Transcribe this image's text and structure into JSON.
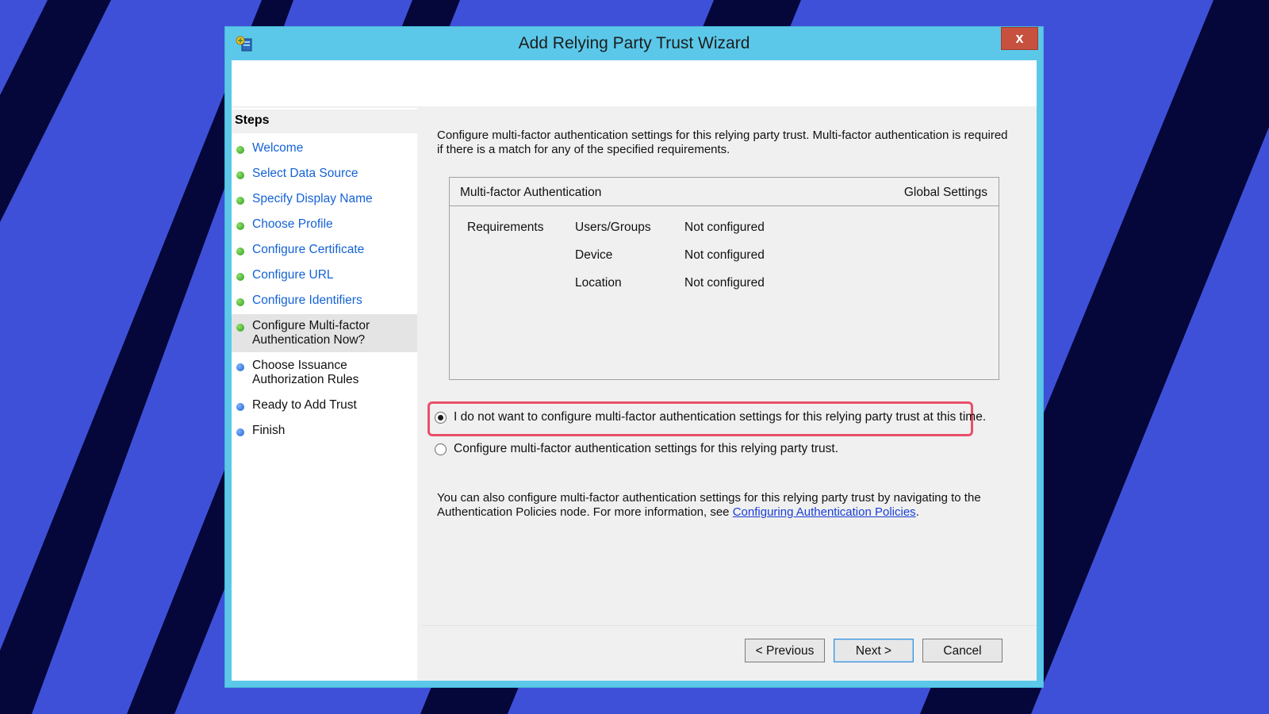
{
  "window": {
    "title": "Add Relying Party Trust Wizard",
    "close_label": "x"
  },
  "steps": {
    "heading": "Steps",
    "items": [
      {
        "label": "Welcome",
        "state": "complete"
      },
      {
        "label": "Select Data Source",
        "state": "complete"
      },
      {
        "label": "Specify Display Name",
        "state": "complete"
      },
      {
        "label": "Choose Profile",
        "state": "complete"
      },
      {
        "label": "Configure Certificate",
        "state": "complete"
      },
      {
        "label": "Configure URL",
        "state": "complete"
      },
      {
        "label": "Configure Identifiers",
        "state": "complete"
      },
      {
        "label": "Configure Multi-factor Authentication Now?",
        "state": "current"
      },
      {
        "label": "Choose Issuance Authorization Rules",
        "state": "pending"
      },
      {
        "label": "Ready to Add Trust",
        "state": "pending"
      },
      {
        "label": "Finish",
        "state": "pending"
      }
    ]
  },
  "content": {
    "intro": "Configure multi-factor authentication settings for this relying party trust. Multi-factor authentication is required if there is a match for any of the specified requirements.",
    "table": {
      "title": "Multi-factor Authentication",
      "global": "Global Settings",
      "requirements_label": "Requirements",
      "rows": [
        {
          "category": "Users/Groups",
          "value": "Not configured"
        },
        {
          "category": "Device",
          "value": "Not configured"
        },
        {
          "category": "Location",
          "value": "Not configured"
        }
      ]
    },
    "options": [
      {
        "label": "I do not want to configure multi-factor authentication settings for this relying party trust at this time.",
        "checked": true
      },
      {
        "label": "Configure multi-factor authentication settings for this relying party trust.",
        "checked": false
      }
    ],
    "info_text": "You can also configure multi-factor authentication settings for this relying party trust by navigating to the Authentication Policies node. For more information, see ",
    "info_link": "Configuring Authentication Policies",
    "info_end": "."
  },
  "buttons": {
    "previous": "< Previous",
    "next": "Next >",
    "cancel": "Cancel"
  },
  "colors": {
    "background": "#3f50d8",
    "stripes": "#05073a",
    "window_frame": "#5bc8ea",
    "link": "#1462d6",
    "highlight": "#e8506a"
  },
  "icons": {
    "app": "server-trust-icon",
    "completed_step": "green-dot-icon",
    "pending_step": "blue-dot-icon"
  }
}
